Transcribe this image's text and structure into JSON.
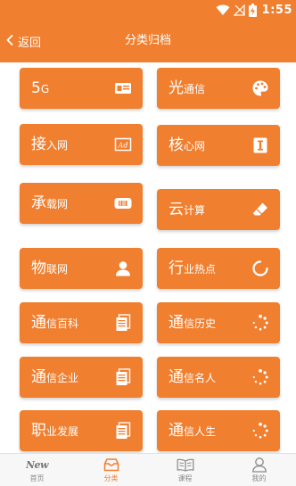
{
  "status": {
    "time": "1:55"
  },
  "header": {
    "back_label": "返回",
    "title": "分类归档"
  },
  "colors": {
    "accent": "#f07f2f",
    "tile_text": "#ffffff",
    "nav_inactive": "#888888"
  },
  "tiles": [
    {
      "first": "5",
      "rest": "G",
      "icon": "id-card-icon"
    },
    {
      "first": "光",
      "rest": "通信",
      "icon": "palette-icon"
    },
    {
      "first": "接",
      "rest": "入网",
      "icon": "ad-icon"
    },
    {
      "first": "核",
      "rest": "心网",
      "icon": "text-cursor-icon"
    },
    {
      "first": "承",
      "rest": "载网",
      "icon": "barcode-icon"
    },
    {
      "first": "云",
      "rest": "计算",
      "icon": "eraser-icon"
    },
    {
      "first": "物",
      "rest": "联网",
      "icon": "user-icon"
    },
    {
      "first": "行",
      "rest": "业热点",
      "icon": "spinner-arc-icon"
    },
    {
      "first": "通",
      "rest": "信百科",
      "icon": "documents-icon"
    },
    {
      "first": "通",
      "rest": "信历史",
      "icon": "spinner-dots-icon"
    },
    {
      "first": "通",
      "rest": "信企业",
      "icon": "documents-icon"
    },
    {
      "first": "通",
      "rest": "信名人",
      "icon": "spinner-dots-icon"
    },
    {
      "first": "职",
      "rest": "业发展",
      "icon": "documents-icon"
    },
    {
      "first": "通",
      "rest": "信人生",
      "icon": "spinner-dots-icon"
    }
  ],
  "nav": [
    {
      "label": "首页",
      "icon": "new-logo-icon",
      "logo_text": "New"
    },
    {
      "label": "分类",
      "icon": "inbox-icon"
    },
    {
      "label": "课程",
      "icon": "book-icon"
    },
    {
      "label": "我的",
      "icon": "person-icon"
    }
  ]
}
